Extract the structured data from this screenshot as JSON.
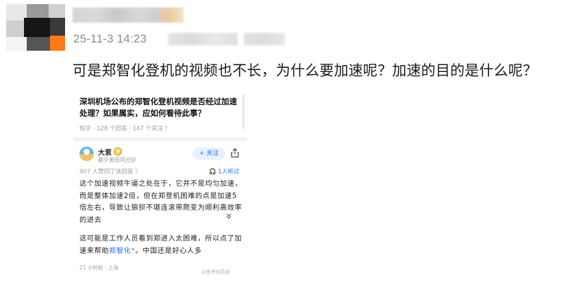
{
  "post": {
    "time": "25-11-3 14:23",
    "text": "可是郑智化登机的视频也不长，为什么要加速呢？加速的目的是什么呢？"
  },
  "screenshot": {
    "question_title_line1": "深圳机场公布的郑智化登机视频是否经过加速",
    "question_title_line2": "处理？如果属实，应如何看待此事？",
    "question_meta": "知乎 · 128 个回答 · 147 个关注 〉",
    "answerer_name": "大衮",
    "answerer_badge": "答",
    "answerer_bio": "晨夕麦田风光好",
    "follow_label": "+ 关注",
    "votes": "907 人赞同了该回答 〉",
    "listen_label": "🎧 1人听过",
    "para1": [
      "这个加速视频牛逼之处在于，它并不是均匀加速，",
      "而是整体加速2倍，但在郑登机困难的点是加速5",
      "倍左右，导致让狼狈不堪连滚带爬变为顺利高效率",
      "的进去"
    ],
    "para2_line1": "这可能是工作人员看到郑进入太困难，所以点了加",
    "para2_line2_prefix": "速来帮助",
    "para2_link": "郑智化",
    "para2_line2_suffix": "⁺。中国还是好心人多",
    "footer": "21 小时前 · 上海",
    "watermark": "@思考的高度"
  }
}
